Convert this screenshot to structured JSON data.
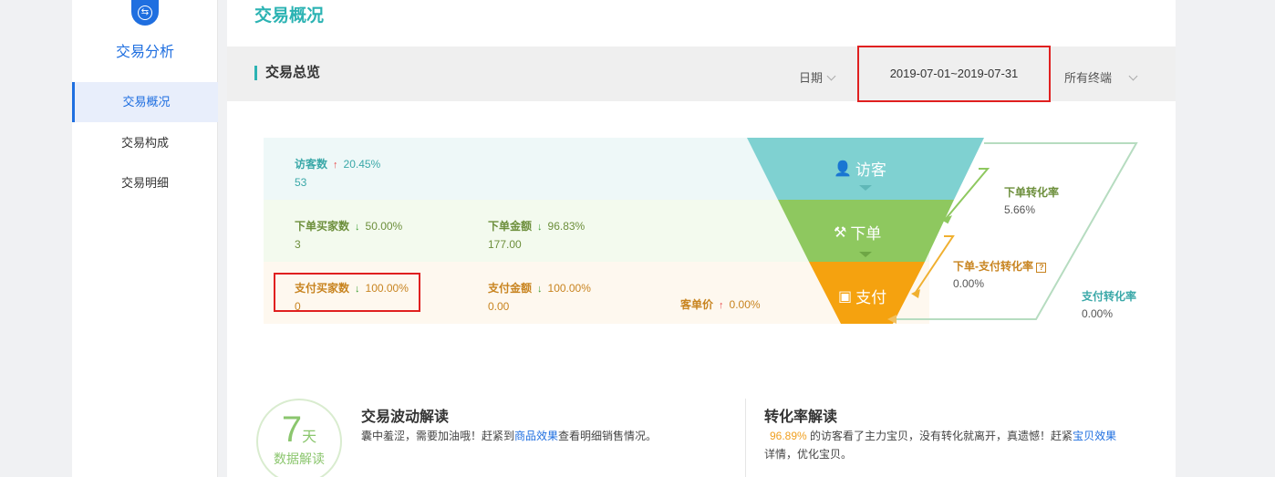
{
  "sidebar": {
    "title": "交易分析",
    "items": [
      {
        "label": "交易概况",
        "active": true
      },
      {
        "label": "交易构成",
        "active": false
      },
      {
        "label": "交易明细",
        "active": false
      }
    ]
  },
  "page": {
    "title": "交易概况"
  },
  "toolbar": {
    "section_title": "交易总览",
    "date_label": "日期",
    "date_range": "2019-07-01~2019-07-31",
    "terminal": "所有终端"
  },
  "funnel": {
    "visitors": {
      "label": "访客数",
      "change": "20.45%",
      "value": "53"
    },
    "order_buyers": {
      "label": "下单买家数",
      "change": "50.00%",
      "value": "3"
    },
    "order_amount": {
      "label": "下单金额",
      "change": "96.83%",
      "value": "177.00"
    },
    "pay_buyers": {
      "label": "支付买家数",
      "change": "100.00%",
      "value": "0"
    },
    "pay_amount": {
      "label": "支付金额",
      "change": "100.00%",
      "value": "0.00"
    },
    "avg_price": {
      "label": "客单价",
      "change": "0.00%"
    },
    "stages": {
      "visit": "访客",
      "order": "下单",
      "pay": "支付"
    },
    "rates": {
      "order_rate": {
        "label": "下单转化率",
        "value": "5.66%"
      },
      "order_pay_rate": {
        "label": "下单-支付转化率",
        "value": "0.00%"
      },
      "pay_rate": {
        "label": "支付转化率",
        "value": "0.00%"
      }
    },
    "colors": {
      "visit": "#7fd1d1",
      "order": "#8ec85f",
      "pay": "#f5a20f"
    }
  },
  "bottom": {
    "badge_number": "7",
    "badge_unit": "天",
    "badge_sub": "数据解读",
    "trade": {
      "title": "交易波动解读",
      "text_before": "囊中羞涩，需要加油哦！赶紧到",
      "link": "商品效果",
      "text_after": "查看明细销售情况。"
    },
    "conversion": {
      "title": "转化率解读",
      "pct": "96.89%",
      "text_before": "的访客看了主力宝贝，没有转化就离开，真遗憾！赶紧",
      "link": "宝贝效果",
      "text_after": "详情，优化宝贝。"
    }
  }
}
